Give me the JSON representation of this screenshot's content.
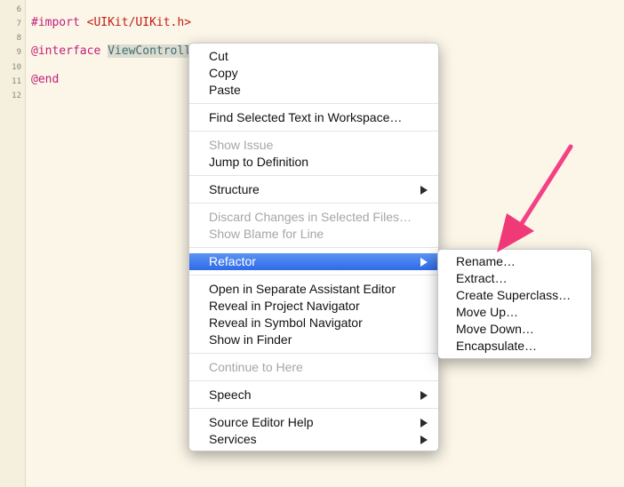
{
  "editor": {
    "line_numbers": [
      "6",
      "7",
      "8",
      "9",
      "10",
      "11",
      "12"
    ],
    "import_keyword": "#import",
    "import_path": "<UIKit/UIKit.h>",
    "interface_keyword": "@interface",
    "class_name": "ViewControll",
    "end_keyword": "@end"
  },
  "context_menu": {
    "cut": "Cut",
    "copy": "Copy",
    "paste": "Paste",
    "find_selected": "Find Selected Text in Workspace…",
    "show_issue": "Show Issue",
    "jump_to_definition": "Jump to Definition",
    "structure": "Structure",
    "discard_changes": "Discard Changes in Selected Files…",
    "show_blame": "Show Blame for Line",
    "refactor": "Refactor",
    "open_assistant": "Open in Separate Assistant Editor",
    "reveal_project": "Reveal in Project Navigator",
    "reveal_symbol": "Reveal in Symbol Navigator",
    "show_in_finder": "Show in Finder",
    "continue_to_here": "Continue to Here",
    "speech": "Speech",
    "source_editor_help": "Source Editor Help",
    "services": "Services"
  },
  "refactor_submenu": {
    "rename": "Rename…",
    "extract": "Extract…",
    "create_superclass": "Create Superclass…",
    "move_up": "Move Up…",
    "move_down": "Move Down…",
    "encapsulate": "Encapsulate…"
  },
  "colors": {
    "editor_background": "#fbf6e7",
    "keyword": "#c21f7a",
    "string": "#c41a16",
    "menu_highlight": "#3a78ee",
    "annotation_arrow": "#f03a78"
  },
  "icons": {
    "submenu_indicator": "chevron-right-icon",
    "annotation": "arrow-icon"
  }
}
